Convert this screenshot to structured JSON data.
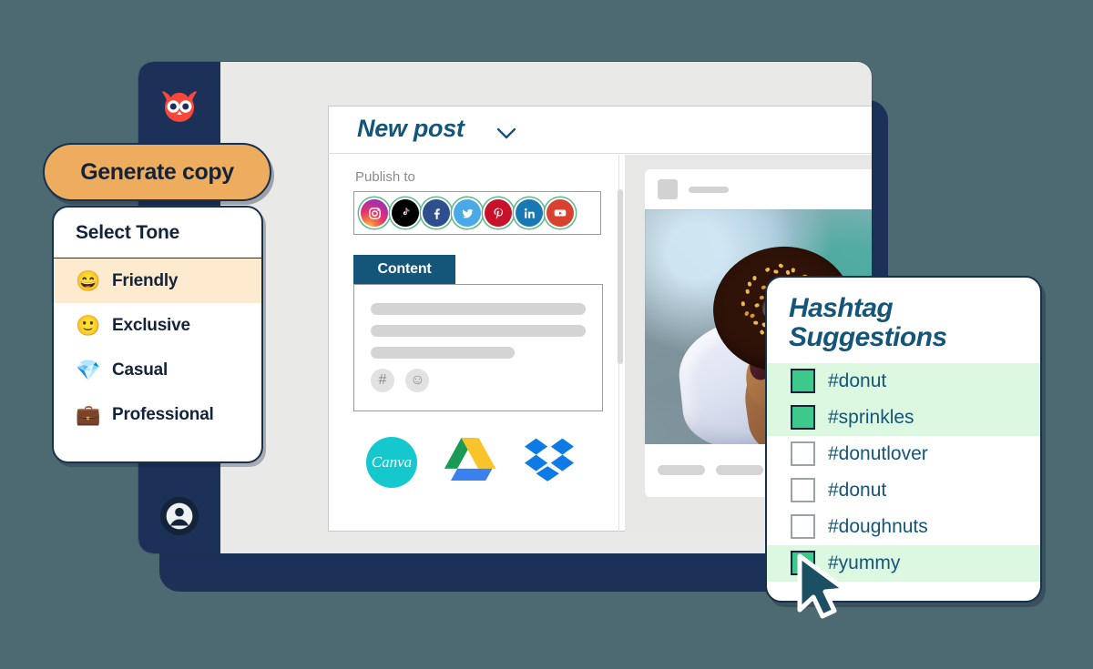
{
  "theme": {
    "background": "#4d6a72",
    "navy": "#1b3157",
    "brand_teal": "#14557a",
    "accent_orange": "#eeac5e",
    "green_check": "#3ec98c",
    "row_highlight": "#ddf8e0",
    "tone_highlight": "#fdeacf",
    "owl_red": "#f9463b"
  },
  "app": {
    "logo_icon": "hootsuite-owl-icon",
    "avatar_icon": "user-avatar-icon"
  },
  "editor": {
    "title": "New post",
    "title_chevron_icon": "chevron-down-icon",
    "publish_label": "Publish to",
    "networks": [
      {
        "name": "instagram",
        "label": "Instagram"
      },
      {
        "name": "tiktok",
        "label": "TikTok"
      },
      {
        "name": "facebook",
        "label": "Facebook"
      },
      {
        "name": "twitter",
        "label": "Twitter"
      },
      {
        "name": "pinterest",
        "label": "Pinterest"
      },
      {
        "name": "linkedin",
        "label": "LinkedIn"
      },
      {
        "name": "youtube",
        "label": "YouTube"
      }
    ],
    "content_tab_label": "Content",
    "composer": {
      "placeholder_lines": [
        3
      ],
      "hashtag_icon": "#",
      "emoji_icon": "☺"
    },
    "attachments": [
      {
        "name": "canva",
        "label": "Canva"
      },
      {
        "name": "google-drive",
        "label": "Google Drive"
      },
      {
        "name": "dropbox",
        "label": "Dropbox"
      }
    ]
  },
  "preview": {
    "image_alt": "hand holding a chocolate glazed donut with golden sprinkles"
  },
  "generate": {
    "button_label": "Generate copy"
  },
  "tone": {
    "title": "Select Tone",
    "options": [
      {
        "emoji": "😄",
        "label": "Friendly",
        "selected": true
      },
      {
        "emoji": "🙂",
        "label": "Exclusive",
        "selected": false
      },
      {
        "emoji": "💎",
        "label": "Casual",
        "selected": false
      },
      {
        "emoji": "💼",
        "label": "Professional",
        "selected": false
      }
    ]
  },
  "hashtags": {
    "title_line1": "Hashtag",
    "title_line2": "Suggestions",
    "items": [
      {
        "label": "#donut",
        "checked": true
      },
      {
        "label": "#sprinkles",
        "checked": true
      },
      {
        "label": "#donutlover",
        "checked": false
      },
      {
        "label": "#donut",
        "checked": false
      },
      {
        "label": "#doughnuts",
        "checked": false
      },
      {
        "label": "#yummy",
        "checked": true
      }
    ]
  },
  "cursor": {
    "icon": "mouse-pointer-icon"
  }
}
